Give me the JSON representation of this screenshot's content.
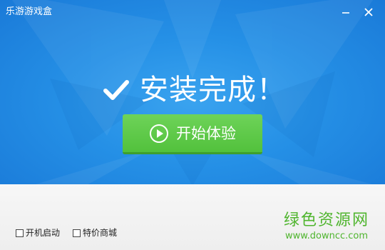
{
  "window": {
    "title": "乐游游戏盒"
  },
  "controls": {
    "minimize_icon": "minimize-icon",
    "close_icon": "close-icon"
  },
  "hero": {
    "icon": "checkmark-icon",
    "message": "安装完成！"
  },
  "start_button": {
    "icon": "play-circle-icon",
    "label": "开始体验"
  },
  "options": [
    {
      "label": "开机启动",
      "checked": false
    },
    {
      "label": "特价商城",
      "checked": false
    }
  ],
  "watermark": {
    "title": "绿色资源网",
    "url": "www.downcc.com"
  },
  "colors": {
    "hero_blue": "#2590e6",
    "button_green": "#5cc845",
    "watermark_green": "#4fb52e",
    "footer_gray": "#f2f2f2"
  }
}
